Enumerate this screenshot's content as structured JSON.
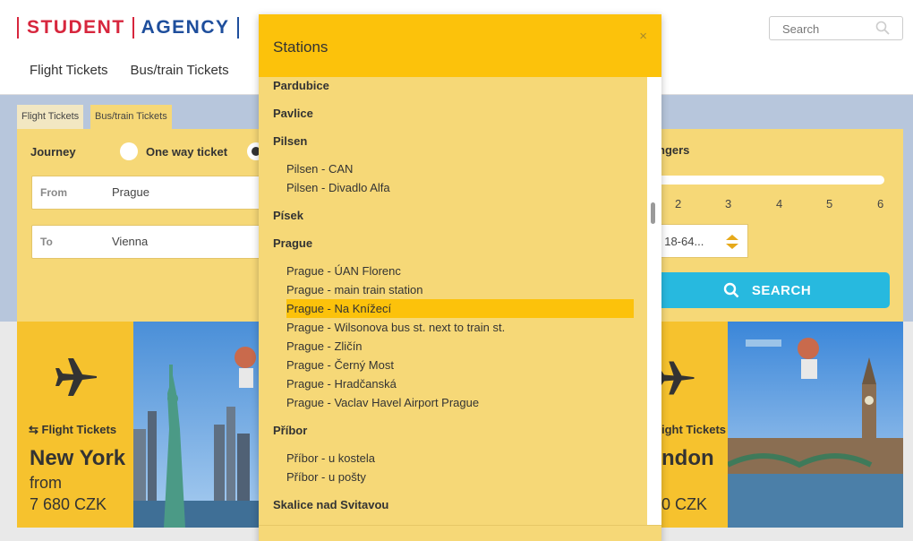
{
  "header": {
    "logo_word1": "STUDENT",
    "logo_word2": "AGENCY",
    "nav": [
      "Flight Tickets",
      "Bus/train Tickets"
    ],
    "search_placeholder": "Search"
  },
  "tabs": [
    "Flight Tickets",
    "Bus/train Tickets"
  ],
  "form": {
    "journey_label": "Journey",
    "one_way_label": "One way ticket",
    "from_label": "From",
    "from_value": "Prague",
    "to_label": "To",
    "to_value": "Vienna",
    "passengers_label": "ngers",
    "passenger_numbers": [
      "2",
      "3",
      "4",
      "5",
      "6"
    ],
    "tariff_value": "t 18-64...",
    "search_button": "SEARCH"
  },
  "promos": [
    {
      "tag": "Flight Tickets",
      "city": "New York",
      "from": "from",
      "price": "7 680 CZK"
    },
    {
      "tag": "ight Tickets",
      "city": "ndon",
      "price": "0 CZK"
    }
  ],
  "modal": {
    "title": "Stations",
    "close": "×",
    "groups": [
      {
        "name": "Pardubice",
        "stations": []
      },
      {
        "name": "Pavlice",
        "stations": []
      },
      {
        "name": "Pilsen",
        "stations": [
          "Pilsen - CAN",
          "Pilsen - Divadlo Alfa"
        ]
      },
      {
        "name": "Písek",
        "stations": []
      },
      {
        "name": "Prague",
        "stations": [
          "Prague - ÚAN Florenc",
          "Prague - main train station",
          "Prague - Na Knížecí",
          "Prague - Wilsonova bus st. next to train st.",
          "Prague - Zličín",
          "Prague - Černý Most",
          "Prague - Hradčanská",
          "Prague - Vaclav Havel Airport Prague"
        ]
      },
      {
        "name": "Příbor",
        "stations": [
          "Příbor - u kostela",
          "Příbor - u pošty"
        ]
      },
      {
        "name": "Skalice nad Svitavou",
        "stations": []
      }
    ],
    "highlighted_station": "Prague - Na Knížecí"
  },
  "colors": {
    "accent_yellow": "#fcc20b",
    "panel_yellow": "#f6d877",
    "search_blue": "#27b9df",
    "logo_red": "#d7263d",
    "logo_blue": "#1e4e9c"
  }
}
